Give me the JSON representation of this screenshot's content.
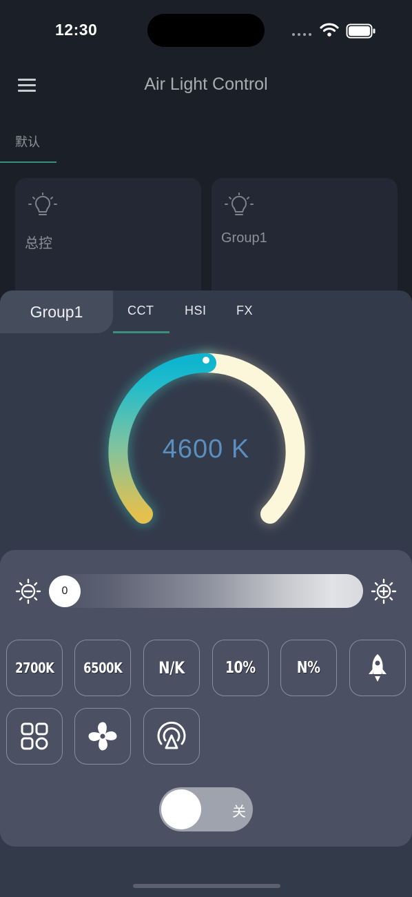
{
  "status_bar": {
    "time": "12:30"
  },
  "header": {
    "title": "Air Light Control"
  },
  "tabs": {
    "default": "默认"
  },
  "groups": [
    {
      "label": "总控"
    },
    {
      "label": "Group1"
    }
  ],
  "sheet": {
    "group_name": "Group1",
    "mode_tabs": [
      "CCT",
      "HSI",
      "FX"
    ],
    "active_mode": "CCT",
    "cct_value": "4600 K"
  },
  "brightness": {
    "value": "0"
  },
  "presets": [
    "2700K",
    "6500K",
    "N/K",
    "10%",
    "N%"
  ],
  "icon_buttons": [
    "rocket-icon",
    "grid-icon",
    "fan-icon",
    "broadcast-icon"
  ],
  "power_toggle": {
    "label": "关"
  },
  "colors": {
    "accent": "#3d8f7d",
    "sheet": "#333a4a",
    "panel": "#4b5062",
    "cct_text": "#5a8fbf"
  }
}
